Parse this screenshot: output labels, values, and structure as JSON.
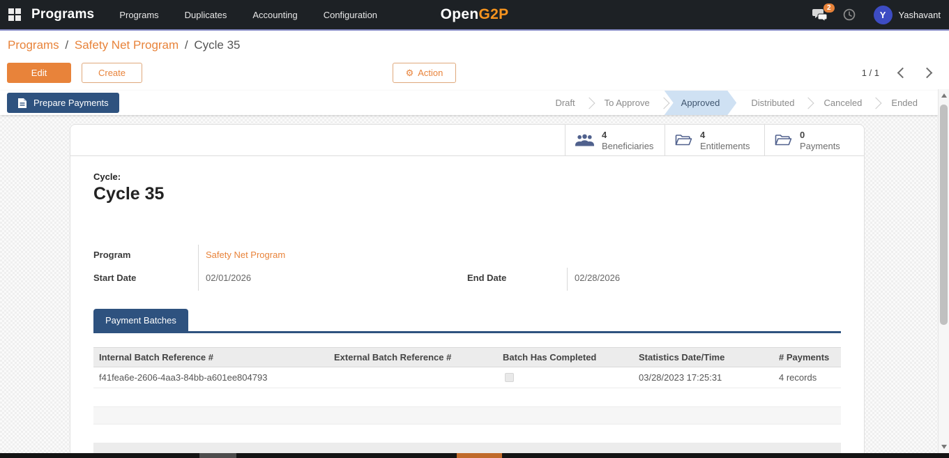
{
  "navbar": {
    "app_title": "Programs",
    "menu_items": [
      "Programs",
      "Duplicates",
      "Accounting",
      "Configuration"
    ],
    "logo_open": "Open",
    "logo_g2p": "G2P",
    "messages_count": "2",
    "user_initial": "Y",
    "user_name": "Yashavant"
  },
  "breadcrumb": {
    "link1": "Programs",
    "link2": "Safety Net Program",
    "current": "Cycle 35",
    "separator": "/"
  },
  "toolbar": {
    "edit_label": "Edit",
    "create_label": "Create",
    "action_label": "Action",
    "gear_glyph": "⚙",
    "pager": "1 / 1"
  },
  "statusbar": {
    "prepare_payments_label": "Prepare Payments",
    "states": [
      {
        "label": "Draft",
        "active": false
      },
      {
        "label": "To Approve",
        "active": false
      },
      {
        "label": "Approved",
        "active": true
      },
      {
        "label": "Distributed",
        "active": false
      },
      {
        "label": "Canceled",
        "active": false
      },
      {
        "label": "Ended",
        "active": false
      }
    ]
  },
  "stats": {
    "beneficiaries": {
      "value": "4",
      "label": "Beneficiaries",
      "icon": "users-icon"
    },
    "entitlements": {
      "value": "4",
      "label": "Entitlements",
      "icon": "folder-open-icon"
    },
    "payments": {
      "value": "0",
      "label": "Payments",
      "icon": "folder-open-icon"
    }
  },
  "form": {
    "cycle_label": "Cycle:",
    "cycle_name": "Cycle 35",
    "program_label": "Program",
    "program_value": "Safety Net Program",
    "start_date_label": "Start Date",
    "start_date_value": "02/01/2026",
    "end_date_label": "End Date",
    "end_date_value": "02/28/2026"
  },
  "notebook": {
    "tab_label": "Payment Batches"
  },
  "table": {
    "headers": [
      "Internal Batch Reference #",
      "External Batch Reference #",
      "Batch Has Completed",
      "Statistics Date/Time",
      "# Payments"
    ],
    "rows": [
      {
        "internal_ref": "f41fea6e-2606-4aa3-84bb-a601ee804793",
        "external_ref": "",
        "completed": false,
        "stats_datetime": "03/28/2023 17:25:31",
        "num_payments": "4 records"
      }
    ]
  },
  "colors": {
    "accent_orange": "#e8833a",
    "logo_orange": "#f7941e",
    "navy": "#2e527f",
    "state_active_bg": "#cfe1f3",
    "navbar_bg": "#1d2125",
    "avatar_blue": "#3d4cc3",
    "badge_orange": "#e8833a"
  }
}
